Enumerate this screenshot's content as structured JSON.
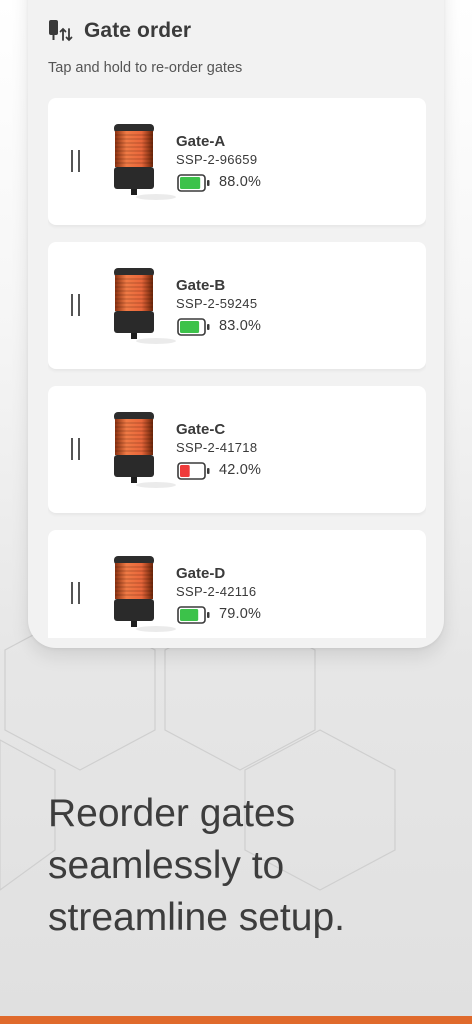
{
  "header": {
    "icon": "gate-reorder-icon",
    "title": "Gate order",
    "subtitle": "Tap and hold to re-order gates"
  },
  "gates": [
    {
      "name": "Gate-A",
      "serial": "SSP-2-96659",
      "battery_text": "88.0%",
      "battery_level": 0.88,
      "battery_color": "#3cc24a"
    },
    {
      "name": "Gate-B",
      "serial": "SSP-2-59245",
      "battery_text": "83.0%",
      "battery_level": 0.83,
      "battery_color": "#3cc24a"
    },
    {
      "name": "Gate-C",
      "serial": "SSP-2-41718",
      "battery_text": "42.0%",
      "battery_level": 0.42,
      "battery_color": "#ef3b3b"
    },
    {
      "name": "Gate-D",
      "serial": "SSP-2-42116",
      "battery_text": "79.0%",
      "battery_level": 0.79,
      "battery_color": "#3cc24a"
    }
  ],
  "tagline": "Reorder gates seamlessly to streamline setup.",
  "colors": {
    "accent": "#e06a2c",
    "device_glow": "#e8663a",
    "battery_good": "#3cc24a",
    "battery_low": "#ef3b3b"
  }
}
